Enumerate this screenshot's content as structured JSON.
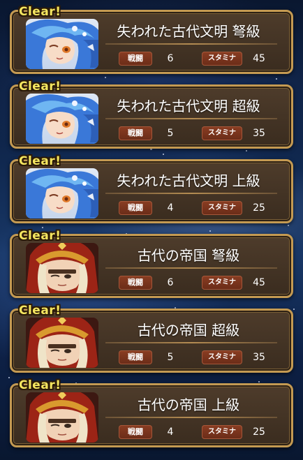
{
  "quests": [
    {
      "clear_label": "Clear!",
      "title": "失われた古代文明 弩級",
      "battle_label": "戦闘",
      "battles": "6",
      "stamina_label": "スタミナ",
      "stamina": "45",
      "character": "blue-haired-girl"
    },
    {
      "clear_label": "Clear!",
      "title": "失われた古代文明 超級",
      "battle_label": "戦闘",
      "battles": "5",
      "stamina_label": "スタミナ",
      "stamina": "35",
      "character": "blue-haired-girl"
    },
    {
      "clear_label": "Clear!",
      "title": "失われた古代文明 上級",
      "battle_label": "戦闘",
      "battles": "4",
      "stamina_label": "スタミナ",
      "stamina": "25",
      "character": "blue-haired-girl"
    },
    {
      "clear_label": "Clear!",
      "title": "古代の帝国 弩級",
      "battle_label": "戦闘",
      "battles": "6",
      "stamina_label": "スタミナ",
      "stamina": "45",
      "character": "red-hooded-man"
    },
    {
      "clear_label": "Clear!",
      "title": "古代の帝国 超級",
      "battle_label": "戦闘",
      "battles": "5",
      "stamina_label": "スタミナ",
      "stamina": "35",
      "character": "red-hooded-man"
    },
    {
      "clear_label": "Clear!",
      "title": "古代の帝国 上級",
      "battle_label": "戦闘",
      "battles": "4",
      "stamina_label": "スタミナ",
      "stamina": "25",
      "character": "red-hooded-man"
    }
  ],
  "colors": {
    "card_border": "#c49a52",
    "card_fill": "#3a2c1f",
    "clear_text": "#f4e660",
    "stat_label_bg": "#6a2c18",
    "background": "#10284f"
  }
}
